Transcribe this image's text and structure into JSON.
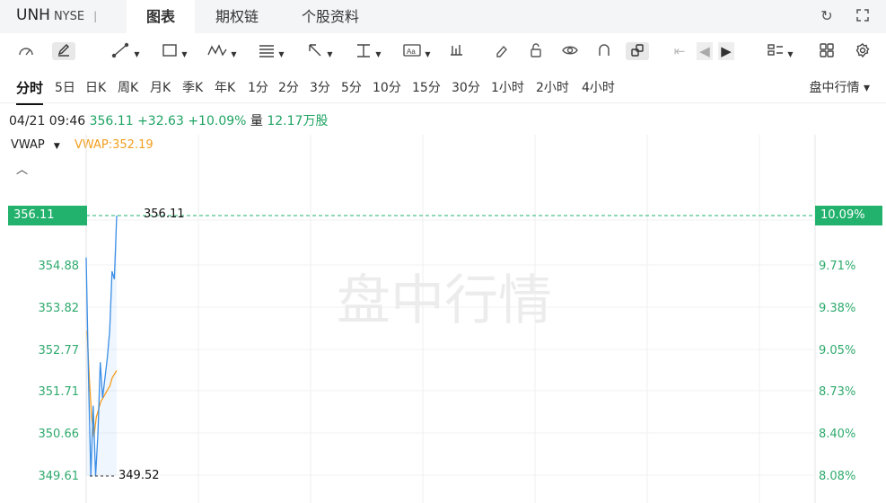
{
  "header": {
    "symbol": "UNH",
    "exchange": "NYSE",
    "separator": "|",
    "tabs": [
      "图表",
      "期权链",
      "个股资料"
    ],
    "active_tab": "图表"
  },
  "periods": [
    "分时",
    "5日",
    "日K",
    "周K",
    "月K",
    "季K",
    "年K",
    "1分",
    "2分",
    "3分",
    "5分",
    "10分",
    "15分",
    "30分",
    "1小时",
    "2小时",
    "4小时"
  ],
  "active_period": "分时",
  "mode_label": "盘中行情",
  "info": {
    "datetime": "04/21 09:46",
    "price": "356.11",
    "change": "+32.63",
    "change_pct": "+10.09%",
    "volume_label": "量",
    "volume": "12.17万股"
  },
  "indicator": {
    "name": "VWAP",
    "value_text": "VWAP:352.19"
  },
  "watermark": "盘中行情",
  "colors": {
    "up": "#1fa463",
    "line": "#3a8ee6",
    "vwap": "#f29e1e",
    "tag": "#23b26d"
  },
  "chart_data": {
    "type": "line",
    "y_price_ticks": [
      "356.11",
      "354.88",
      "353.82",
      "352.77",
      "351.71",
      "350.66",
      "349.61"
    ],
    "y_pct_ticks": [
      "10.09%",
      "9.71%",
      "9.38%",
      "9.05%",
      "8.73%",
      "8.40%",
      "8.08%"
    ],
    "last_price_tag": "356.11",
    "last_pct_tag": "10.09%",
    "high_label": "356.11",
    "low_label": "349.52",
    "ylim": [
      349.52,
      356.11
    ],
    "series": [
      {
        "name": "price",
        "values": [
          355.05,
          352.0,
          349.52,
          351.3,
          349.52,
          350.6,
          352.4,
          351.5,
          352.0,
          352.5,
          353.2,
          354.7,
          354.5,
          356.11
        ]
      },
      {
        "name": "VWAP",
        "values": [
          353.2,
          352.0,
          351.0,
          350.5,
          351.0,
          351.2,
          351.4,
          351.5,
          351.6,
          351.7,
          351.8,
          352.0,
          352.1,
          352.19
        ]
      }
    ]
  }
}
